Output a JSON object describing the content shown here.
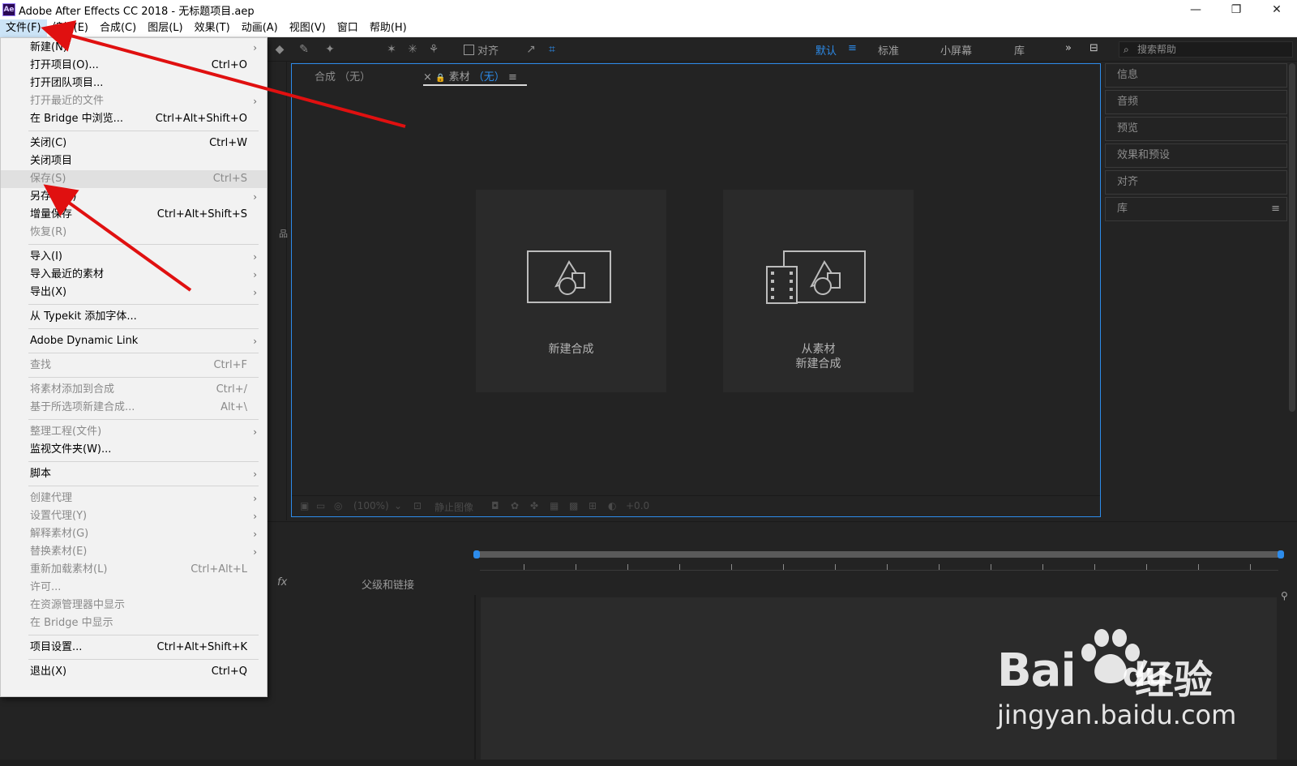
{
  "titlebar": {
    "app_icon": "Ae",
    "title": "Adobe After Effects CC 2018 - 无标题项目.aep",
    "minimize": "—",
    "restore": "❐",
    "close": "✕"
  },
  "menubar": {
    "items": [
      "文件(F)",
      "编辑(E)",
      "合成(C)",
      "图层(L)",
      "效果(T)",
      "动画(A)",
      "视图(V)",
      "窗口",
      "帮助(H)"
    ],
    "active_index": 0
  },
  "toolbar": {
    "snap_label": "对齐",
    "workspaces": [
      "默认",
      "标准",
      "小屏幕",
      "库"
    ],
    "active_workspace": "默认",
    "more": "»",
    "search_placeholder": "搜索帮助"
  },
  "file_menu": {
    "items": [
      {
        "label": "新建(N)",
        "shortcut": "",
        "submenu": true,
        "disabled": false
      },
      {
        "label": "打开项目(O)...",
        "shortcut": "Ctrl+O",
        "submenu": false,
        "disabled": false
      },
      {
        "label": "打开团队项目...",
        "shortcut": "",
        "submenu": false,
        "disabled": false
      },
      {
        "label": "打开最近的文件",
        "shortcut": "",
        "submenu": true,
        "disabled": true
      },
      {
        "label": "在 Bridge 中浏览...",
        "shortcut": "Ctrl+Alt+Shift+O",
        "submenu": false,
        "disabled": false
      },
      {
        "sep": true
      },
      {
        "label": "关闭(C)",
        "shortcut": "Ctrl+W",
        "submenu": false,
        "disabled": false
      },
      {
        "label": "关闭项目",
        "shortcut": "",
        "submenu": false,
        "disabled": false
      },
      {
        "label": "保存(S)",
        "shortcut": "Ctrl+S",
        "submenu": false,
        "disabled": true,
        "hover": true
      },
      {
        "label": "另存为(S)",
        "shortcut": "",
        "submenu": true,
        "disabled": false
      },
      {
        "label": "增量保存",
        "shortcut": "Ctrl+Alt+Shift+S",
        "submenu": false,
        "disabled": false
      },
      {
        "label": "恢复(R)",
        "shortcut": "",
        "submenu": false,
        "disabled": true
      },
      {
        "sep": true
      },
      {
        "label": "导入(I)",
        "shortcut": "",
        "submenu": true,
        "disabled": false
      },
      {
        "label": "导入最近的素材",
        "shortcut": "",
        "submenu": true,
        "disabled": false
      },
      {
        "label": "导出(X)",
        "shortcut": "",
        "submenu": true,
        "disabled": false
      },
      {
        "sep": true
      },
      {
        "label": "从 Typekit 添加字体...",
        "shortcut": "",
        "submenu": false,
        "disabled": false
      },
      {
        "sep": true
      },
      {
        "label": "Adobe Dynamic Link",
        "shortcut": "",
        "submenu": true,
        "disabled": false
      },
      {
        "sep": true
      },
      {
        "label": "查找",
        "shortcut": "Ctrl+F",
        "submenu": false,
        "disabled": true
      },
      {
        "sep": true
      },
      {
        "label": "将素材添加到合成",
        "shortcut": "Ctrl+/",
        "submenu": false,
        "disabled": true
      },
      {
        "label": "基于所选项新建合成...",
        "shortcut": "Alt+\\",
        "submenu": false,
        "disabled": true
      },
      {
        "sep": true
      },
      {
        "label": "整理工程(文件)",
        "shortcut": "",
        "submenu": true,
        "disabled": true
      },
      {
        "label": "监视文件夹(W)...",
        "shortcut": "",
        "submenu": false,
        "disabled": false
      },
      {
        "sep": true
      },
      {
        "label": "脚本",
        "shortcut": "",
        "submenu": true,
        "disabled": false
      },
      {
        "sep": true
      },
      {
        "label": "创建代理",
        "shortcut": "",
        "submenu": true,
        "disabled": true
      },
      {
        "label": "设置代理(Y)",
        "shortcut": "",
        "submenu": true,
        "disabled": true
      },
      {
        "label": "解释素材(G)",
        "shortcut": "",
        "submenu": true,
        "disabled": true
      },
      {
        "label": "替换素材(E)",
        "shortcut": "",
        "submenu": true,
        "disabled": true
      },
      {
        "label": "重新加载素材(L)",
        "shortcut": "Ctrl+Alt+L",
        "submenu": false,
        "disabled": true
      },
      {
        "label": "许可...",
        "shortcut": "",
        "submenu": false,
        "disabled": true
      },
      {
        "label": "在资源管理器中显示",
        "shortcut": "",
        "submenu": false,
        "disabled": true
      },
      {
        "label": "在 Bridge 中显示",
        "shortcut": "",
        "submenu": false,
        "disabled": true
      },
      {
        "sep": true
      },
      {
        "label": "项目设置...",
        "shortcut": "Ctrl+Alt+Shift+K",
        "submenu": false,
        "disabled": false
      },
      {
        "sep": true
      },
      {
        "label": "退出(X)",
        "shortcut": "Ctrl+Q",
        "submenu": false,
        "disabled": false
      }
    ]
  },
  "viewer": {
    "tab_comp": "合成 （无）",
    "tab_material_close": "×",
    "tab_material_lock": "🔒",
    "tab_material": "素材",
    "tab_material_none": "（无）",
    "tab_menu": "≡",
    "card_new_comp": "新建合成",
    "card_from_footage_line1": "从素材",
    "card_from_footage_line2": "新建合成",
    "zoom": "(100%)",
    "still_image": "静止图像",
    "exposure": "+0.0"
  },
  "right_panels": {
    "items": [
      "信息",
      "音频",
      "预览",
      "效果和预设",
      "对齐",
      "库"
    ],
    "menu_icon": "≡"
  },
  "timeline": {
    "fx_label": "fx",
    "parent_label": "父级和链接"
  },
  "watermark": {
    "bai": "Bai",
    "du": "du",
    "jingyan": "经验",
    "url": "jingyan.baidu.com"
  },
  "colors": {
    "accent": "#2d8ceb",
    "arrow": "#e01010",
    "panel_bg": "#232323"
  }
}
